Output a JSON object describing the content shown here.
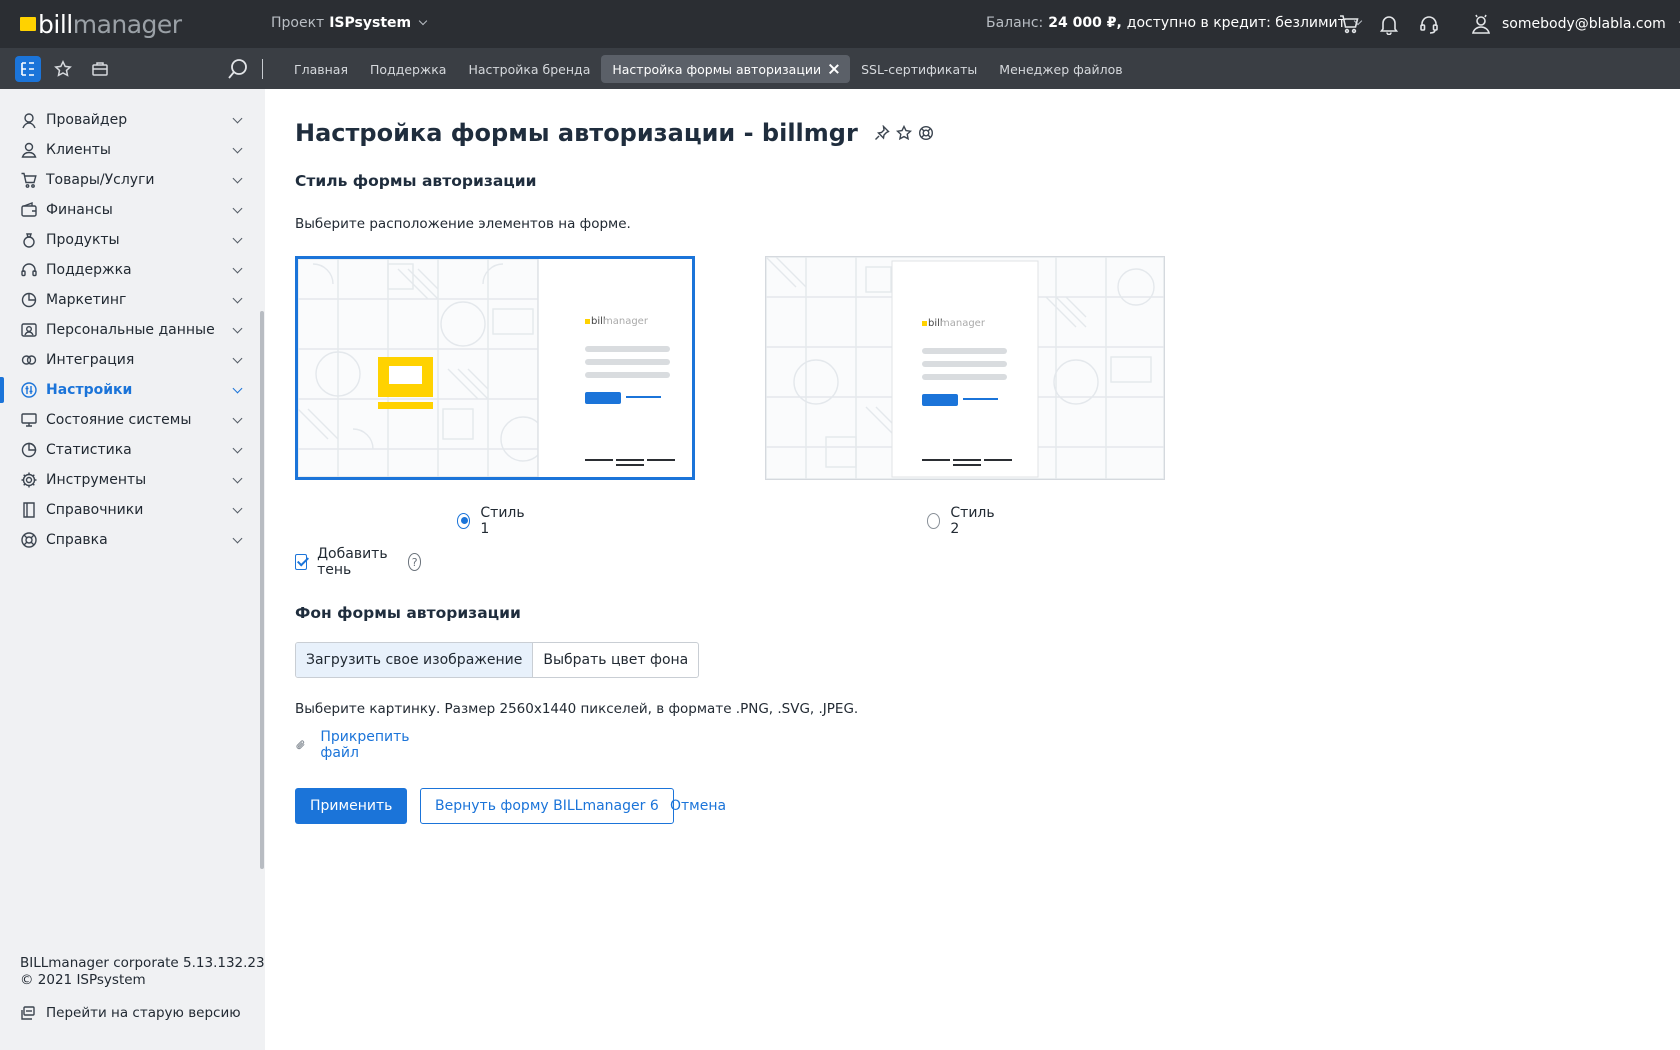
{
  "header": {
    "logo_bill": "bill",
    "logo_manager": "manager",
    "project_label": "Проект",
    "project_name": "ISPsystem",
    "balance_label": "Баланс:",
    "balance_value": "24 000 ₽,",
    "credit_text": "доступно в кредит: безлимит",
    "user_email": "somebody@blabla.com"
  },
  "tabs": [
    {
      "label": "Главная"
    },
    {
      "label": "Поддержка"
    },
    {
      "label": "Настройка бренда"
    },
    {
      "label": "Настройка формы авторизации",
      "active": true
    },
    {
      "label": "SSL-сертификаты"
    },
    {
      "label": "Менеджер файлов"
    }
  ],
  "sidebar": {
    "items": [
      {
        "label": "Провайдер",
        "icon": "provider-icon"
      },
      {
        "label": "Клиенты",
        "icon": "clients-icon"
      },
      {
        "label": "Товары/Услуги",
        "icon": "cart-icon"
      },
      {
        "label": "Финансы",
        "icon": "wallet-icon"
      },
      {
        "label": "Продукты",
        "icon": "products-icon"
      },
      {
        "label": "Поддержка",
        "icon": "headset-icon"
      },
      {
        "label": "Маркетинг",
        "icon": "pie-icon"
      },
      {
        "label": "Персональные данные",
        "icon": "user-data-icon"
      },
      {
        "label": "Интеграция",
        "icon": "integration-icon"
      },
      {
        "label": "Настройки",
        "icon": "settings-icon",
        "active": true
      },
      {
        "label": "Состояние системы",
        "icon": "monitor-icon"
      },
      {
        "label": "Статистика",
        "icon": "stats-icon"
      },
      {
        "label": "Инструменты",
        "icon": "gear-icon"
      },
      {
        "label": "Справочники",
        "icon": "book-icon"
      },
      {
        "label": "Справка",
        "icon": "lifebuoy-icon"
      }
    ],
    "version_line1": "BILLmanager corporate  5.13.132.23",
    "version_line2": "© 2021 ISPsystem",
    "old_version": "Перейти на старую версию"
  },
  "page": {
    "title": "Настройка формы авторизации - billmgr",
    "style_heading": "Стиль формы авторизации",
    "style_hint": "Выберите расположение элементов на форме.",
    "style1_label": "Стиль 1",
    "style2_label": "Стиль 2",
    "selected_style": 1,
    "shadow_label": "Добавить тень",
    "shadow_checked": true,
    "help_mark": "?",
    "background_heading": "Фон формы авторизации",
    "bg_option_upload": "Загрузить свое изображение",
    "bg_option_color": "Выбрать цвет фона",
    "bg_hint": "Выберите картинку. Размер 2560x1440 пикселей, в формате .PNG, .SVG, .JPEG.",
    "attach_label": "Прикрепить файл",
    "apply_label": "Применить",
    "reset_label": "Вернуть форму BILLmanager 6",
    "cancel_label": "Отмена",
    "preview_logo_bill": "bill",
    "preview_logo_manager": "manager"
  },
  "colors": {
    "accent": "#1b74d9",
    "brand_yellow": "#ffd200",
    "topbar": "#2b2e33",
    "navbar": "#3a3e44"
  }
}
